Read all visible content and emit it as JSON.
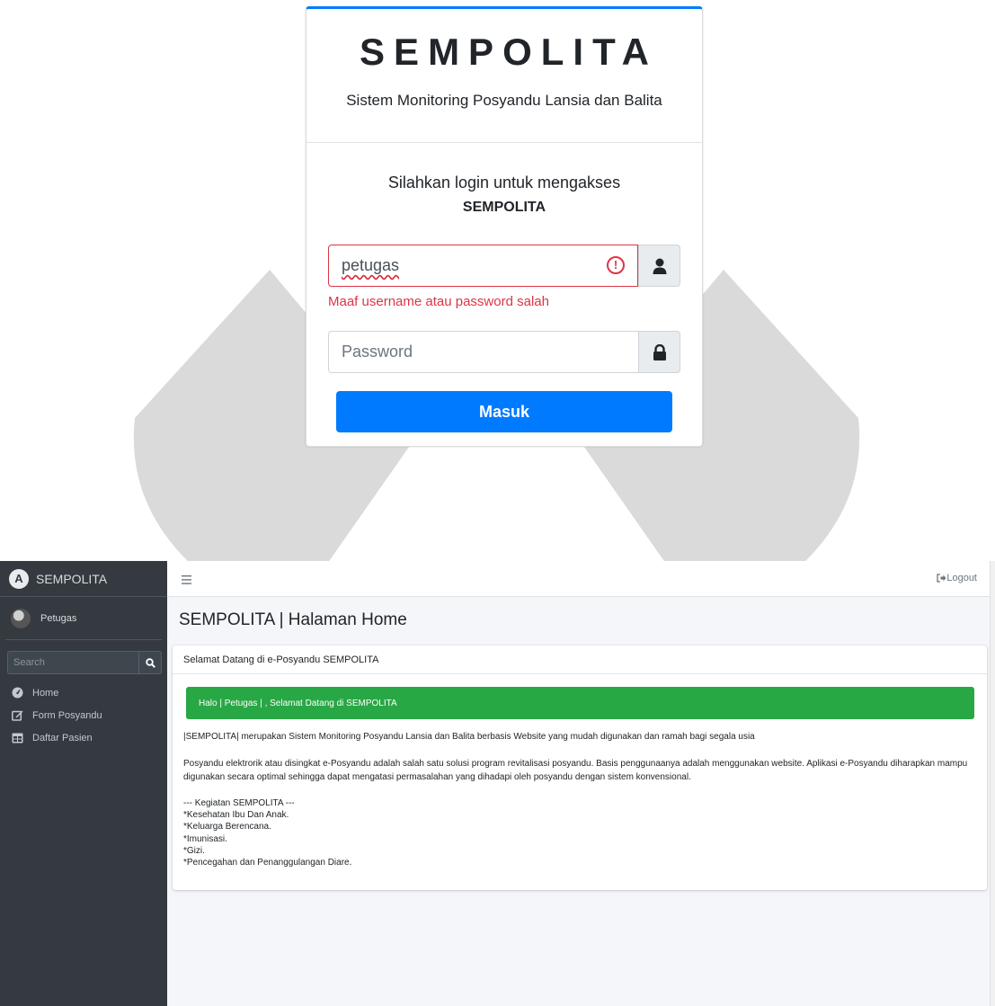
{
  "login": {
    "brand": "SEMPOLITA",
    "subtitle": "Sistem Monitoring Posyandu Lansia dan Balita",
    "message_line1": "Silahkan login untuk mengakses",
    "message_line2": "SEMPOLITA",
    "username_value": "petugas",
    "username_error_icon": "exclamation-circle-icon",
    "username_addon_icon": "user-icon",
    "error_text": "Maaf username atau password salah",
    "password_placeholder": "Password",
    "password_addon_icon": "lock-icon",
    "submit_label": "Masuk",
    "colors": {
      "accent": "#007bff",
      "error": "#dc3545"
    }
  },
  "dashboard": {
    "sidebar": {
      "brand": "SEMPOLITA",
      "user": "Petugas",
      "search_placeholder": "Search",
      "items": [
        {
          "label": "Home",
          "icon": "tachometer-icon"
        },
        {
          "label": "Form Posyandu",
          "icon": "edit-icon"
        },
        {
          "label": "Daftar Pasien",
          "icon": "table-icon"
        }
      ]
    },
    "topbar": {
      "menu_icon": "hamburger-icon",
      "logout_label": "Logout",
      "logout_icon": "sign-out-icon"
    },
    "page_title": "SEMPOLITA | Halaman Home",
    "card": {
      "header": "Selamat Datang di e-Posyandu SEMPOLITA",
      "alert": "Halo | Petugas | , Selamat Datang di SEMPOLITA",
      "paragraph1": "|SEMPOLITA| merupakan Sistem Monitoring Posyandu Lansia dan Balita berbasis Website yang mudah digunakan dan ramah bagi segala usia",
      "paragraph2": "Posyandu elektrorik atau disingkat e-Posyandu adalah salah satu solusi program revitalisasi posyandu. Basis penggunaanya adalah menggunakan website. Aplikasi e-Posyandu diharapkan mampu digunakan secara optimal sehingga dapat mengatasi permasalahan yang dihadapi oleh posyandu dengan sistem konvensional.",
      "activities_title": "--- Kegiatan SEMPOLITA ---",
      "activities": [
        "*Kesehatan Ibu Dan Anak.",
        "*Keluarga Berencana.",
        "*Imunisasi.",
        "*Gizi.",
        "*Pencegahan dan Penanggulangan Diare."
      ]
    },
    "colors": {
      "sidebar": "#343a40",
      "success": "#28a745"
    }
  }
}
